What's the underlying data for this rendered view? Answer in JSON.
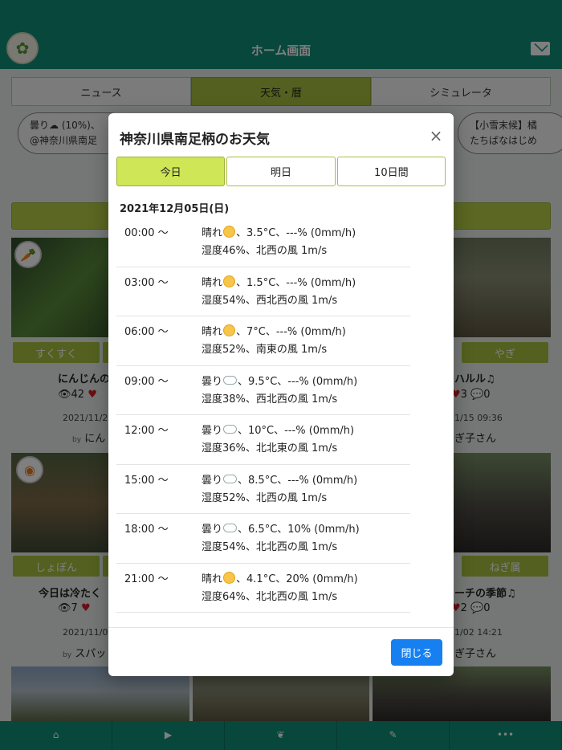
{
  "header": {
    "title": "ホーム画面"
  },
  "top_tabs": [
    "ニュース",
    "天気・暦",
    "シミュレータ"
  ],
  "tickers": {
    "left": [
      "曇り☁ (10%)、",
      "@神奈川県南足"
    ],
    "right": [
      "【小雪末候】橘",
      "たちばなはじめ"
    ]
  },
  "cards": [
    {
      "tag": "すくすく",
      "title": "にんじんの",
      "views": "42",
      "date": "2021/11/2",
      "by": "by",
      "user": "にん"
    },
    {
      "tag": "やぎ",
      "title": "ハルル♫",
      "likes": "3",
      "comments": "0",
      "date": "1/15 09:36",
      "user": "ぎ子さん"
    },
    {
      "tag": "しょぼん",
      "title": "今日は冷たく",
      "views": "7",
      "date": "2021/11/0",
      "by": "by",
      "user": "スパッ"
    },
    {
      "tag": "ねぎ属",
      "title": "ーチの季節♫",
      "likes": "2",
      "comments": "0",
      "date": "1/02 14:21",
      "user": "ぎ子さん"
    }
  ],
  "modal": {
    "title": "神奈川県南足柄のお天気",
    "close_symbol": "×",
    "tabs": [
      "今日",
      "明日",
      "10日間"
    ],
    "date": "2021年12月05日(日)",
    "rows": [
      {
        "time": "00:00 〜",
        "cond": "晴れ",
        "icon": "sun-icon",
        "rest": "、3.5°C、---% (0mm/h)",
        "detail": "湿度46%、北西の風 1m/s"
      },
      {
        "time": "03:00 〜",
        "cond": "晴れ",
        "icon": "sun-icon",
        "rest": "、1.5°C、---% (0mm/h)",
        "detail": "湿度54%、西北西の風 1m/s"
      },
      {
        "time": "06:00 〜",
        "cond": "晴れ",
        "icon": "sun-icon",
        "rest": "、7°C、---% (0mm/h)",
        "detail": "湿度52%、南東の風 1m/s"
      },
      {
        "time": "09:00 〜",
        "cond": "曇り",
        "icon": "cloud-icon",
        "rest": "、9.5°C、---% (0mm/h)",
        "detail": "湿度38%、西北西の風 1m/s"
      },
      {
        "time": "12:00 〜",
        "cond": "曇り",
        "icon": "cloud-icon",
        "rest": "、10°C、---% (0mm/h)",
        "detail": "湿度36%、北北東の風 1m/s"
      },
      {
        "time": "15:00 〜",
        "cond": "曇り",
        "icon": "cloud-icon",
        "rest": "、8.5°C、---% (0mm/h)",
        "detail": "湿度52%、北西の風 1m/s"
      },
      {
        "time": "18:00 〜",
        "cond": "曇り",
        "icon": "cloud-icon",
        "rest": "、6.5°C、10% (0mm/h)",
        "detail": "湿度54%、北北西の風 1m/s"
      },
      {
        "time": "21:00 〜",
        "cond": "晴れ",
        "icon": "sun-icon",
        "rest": "、4.1°C、20% (0mm/h)",
        "detail": "湿度64%、北北西の風 1m/s"
      }
    ],
    "close_button": "閉じる"
  }
}
